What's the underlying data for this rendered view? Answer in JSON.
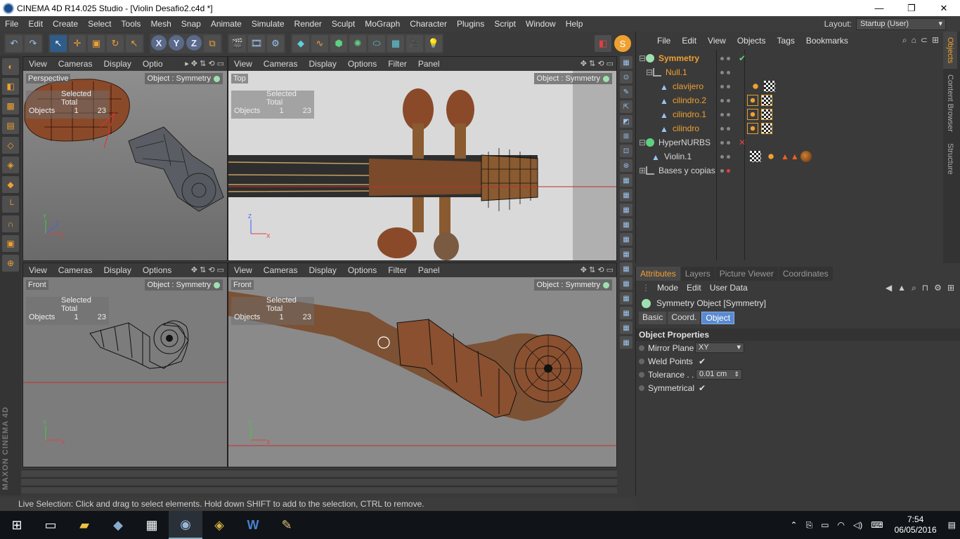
{
  "window": {
    "title": "CINEMA 4D R14.025 Studio - [Violin Desafio2.c4d *]",
    "minimize": "—",
    "restore": "❐",
    "close": "✕"
  },
  "menu": [
    "File",
    "Edit",
    "Create",
    "Select",
    "Tools",
    "Mesh",
    "Snap",
    "Animate",
    "Simulate",
    "Render",
    "Sculpt",
    "MoGraph",
    "Character",
    "Plugins",
    "Script",
    "Window",
    "Help"
  ],
  "layout": {
    "label": "Layout:",
    "value": "Startup (User)"
  },
  "viewport_menu": [
    "View",
    "Cameras",
    "Display",
    "Options",
    "Filter",
    "Panel"
  ],
  "viewport_menu_short": [
    "View",
    "Cameras",
    "Display",
    "Optio"
  ],
  "viewport_menu_bl": [
    "View",
    "Cameras",
    "Display",
    "Options"
  ],
  "hud": {
    "selected_total": "Selected Total",
    "objects": "Objects",
    "selected": "1",
    "total": "23"
  },
  "viewports": {
    "tl": {
      "label": "Perspective",
      "object": "Object : Symmetry"
    },
    "tr": {
      "label": "Top",
      "object": "Object : Symmetry"
    },
    "bl": {
      "label": "Front",
      "object": "Object : Symmetry"
    },
    "br": {
      "label": "Front",
      "object": "Object : Symmetry"
    }
  },
  "objmgr": {
    "menu": [
      "File",
      "Edit",
      "View",
      "Objects",
      "Tags",
      "Bookmarks"
    ],
    "tree": [
      {
        "name": "Symmetry",
        "style": "selected"
      },
      {
        "name": "Null.1",
        "style": "orange"
      },
      {
        "name": "clavijero",
        "style": "orange"
      },
      {
        "name": "cilindro.2",
        "style": "orange"
      },
      {
        "name": "cilindro.1",
        "style": "orange"
      },
      {
        "name": "cilindro",
        "style": "orange"
      },
      {
        "name": "HyperNURBS",
        "style": "normal"
      },
      {
        "name": "Violin.1",
        "style": "normal"
      },
      {
        "name": "Bases y copias",
        "style": "normal"
      }
    ],
    "side_tabs": [
      "Objects",
      "Content Browser",
      "Structure"
    ]
  },
  "attributes": {
    "tabs": [
      "Attributes",
      "Layers",
      "Picture Viewer",
      "Coordinates"
    ],
    "modes": [
      "Mode",
      "Edit",
      "User Data"
    ],
    "object_title": "Symmetry Object [Symmetry]",
    "subtabs": [
      "Basic",
      "Coord.",
      "Object"
    ],
    "section": "Object Properties",
    "props": {
      "mirror_plane": {
        "label": "Mirror Plane",
        "value": "XY"
      },
      "weld_points": {
        "label": "Weld Points",
        "value": "✔"
      },
      "tolerance": {
        "label": "Tolerance . .",
        "value": "0.01 cm"
      },
      "symmetrical": {
        "label": "Symmetrical",
        "value": "✔"
      }
    }
  },
  "status": "Live Selection: Click and drag to select elements. Hold down SHIFT to add to the selection, CTRL to remove.",
  "brand": "MAXON CINEMA 4D",
  "clock": {
    "time": "7:54",
    "date": "06/05/2016"
  },
  "colors": {
    "accent": "#f0a030",
    "selection": "#5a8ad0",
    "symmetry_icon": "#9fe0b0"
  }
}
